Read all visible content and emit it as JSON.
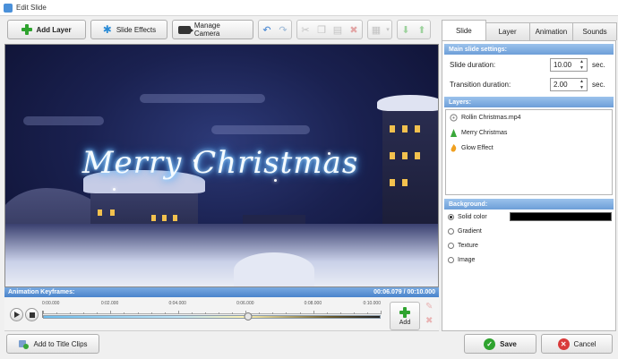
{
  "window": {
    "title": "Edit Slide"
  },
  "toolbar": {
    "add_layer": "Add Layer",
    "slide_effects": "Slide Effects",
    "manage_camera": "Manage Camera"
  },
  "preview": {
    "caption": "Merry Christmas"
  },
  "keyframes": {
    "label": "Animation Keyframes:",
    "time": "00:06.079 / 00:10.000",
    "ticks": [
      "0:00.000",
      "0:02.000",
      "0:04.000",
      "0:06.000",
      "0:08.000",
      "0:10.000"
    ],
    "position_fraction": 0.608,
    "add_label": "Add"
  },
  "tabs": [
    "Slide",
    "Layer",
    "Animation",
    "Sounds"
  ],
  "slide_settings": {
    "heading": "Main slide settings:",
    "duration_label": "Slide duration:",
    "duration_value": "10.00",
    "transition_label": "Transition duration:",
    "transition_value": "2.00",
    "unit": "sec."
  },
  "layers": {
    "heading": "Layers:",
    "items": [
      "Rollin Christmas.mp4",
      "Merry Christmas",
      "Glow Effect"
    ]
  },
  "background": {
    "heading": "Background:",
    "options": [
      "Solid color",
      "Gradient",
      "Texture",
      "Image"
    ],
    "selected": "Solid color",
    "color": "#000000"
  },
  "footer": {
    "add_to_title_clips": "Add to Title Clips",
    "save": "Save",
    "cancel": "Cancel"
  },
  "colors": {
    "accent": "#4a84cc",
    "save_green": "#2fa32f",
    "cancel_red": "#d93a3a"
  }
}
